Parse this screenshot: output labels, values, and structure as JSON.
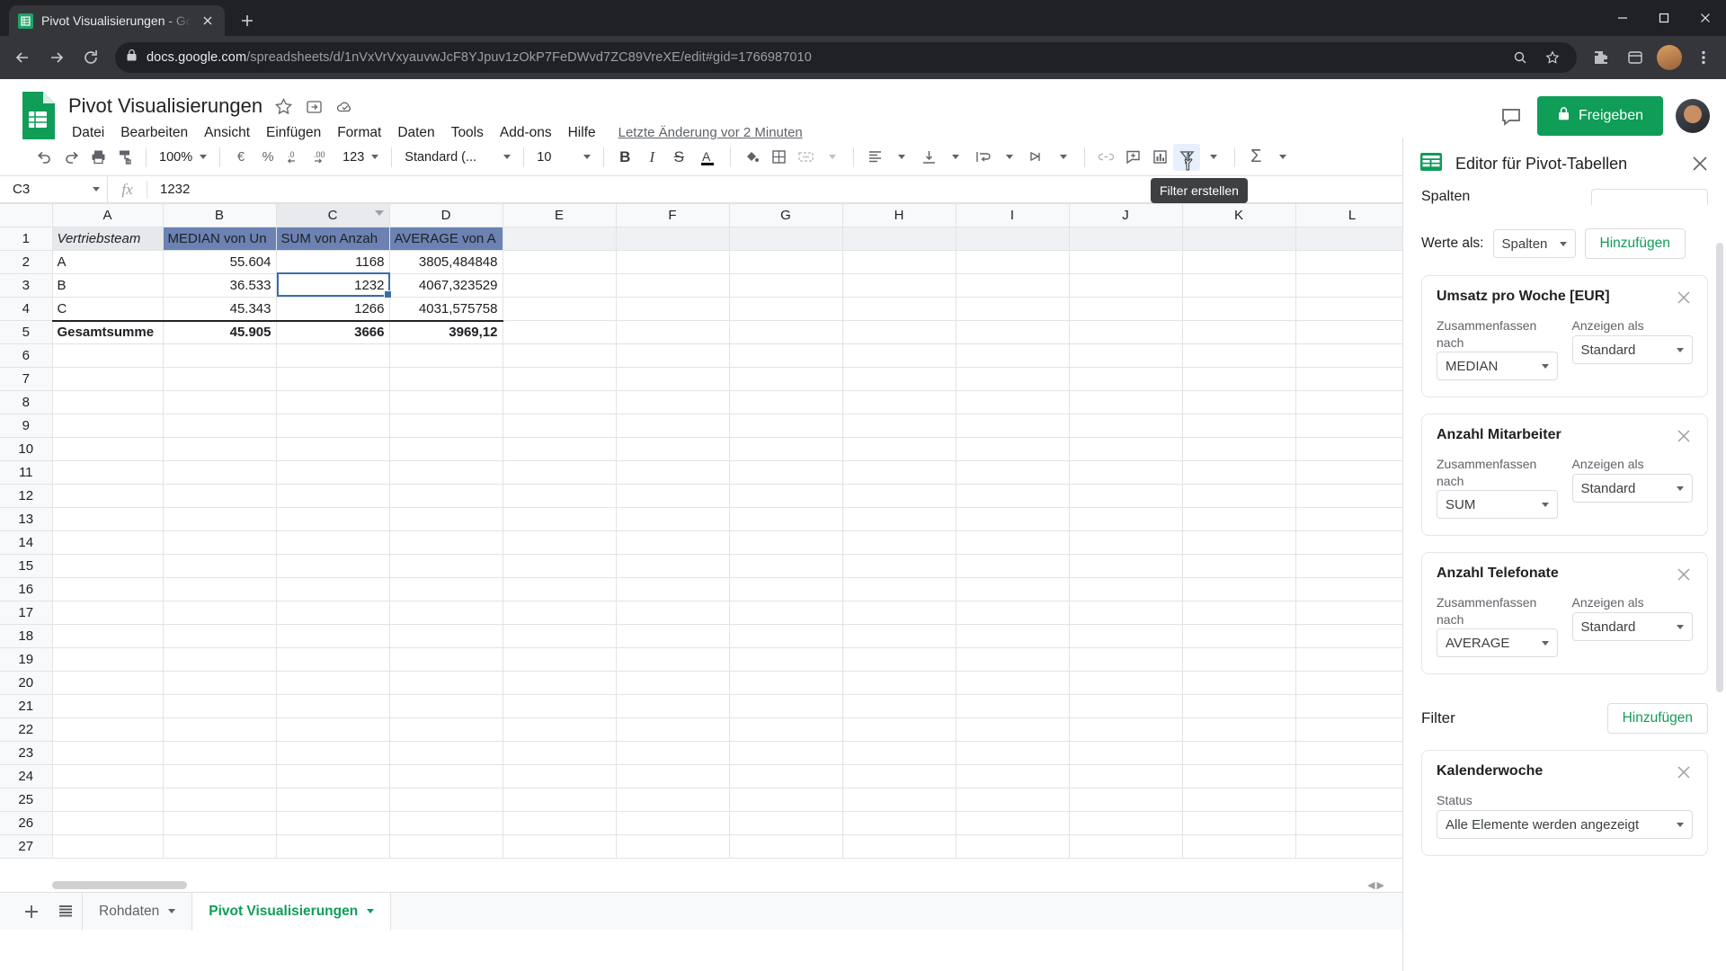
{
  "browser": {
    "tab": {
      "title": "Pivot Visualisierungen - Google T",
      "favicon": "sheets-icon",
      "close": "close-icon"
    },
    "new_tab_label": "+",
    "window_controls": {
      "minimize": "minimize-icon",
      "maximize": "maximize-icon",
      "close": "close-icon"
    },
    "nav": {
      "back": "back-arrow-icon",
      "forward": "forward-arrow-icon",
      "reload": "reload-icon"
    },
    "omnibox": {
      "lock": "lock-icon",
      "domain": "docs.google.com",
      "path": "/spreadsheets/d/1nVxVrVxyauvwJcF8YJpuv1zOkP7FeDWvd7ZC89VreXE/edit#gid=1766987010",
      "zoom_icon": "zoom-icon",
      "star_icon": "star-icon",
      "extensions_icon": "extensions-icon",
      "profile_icon": "profile-icon",
      "menu_icon": "more-vert-icon"
    }
  },
  "docs": {
    "title": "Pivot Visualisierungen",
    "title_icons": [
      "star-icon",
      "move-to-folder-icon",
      "cloud-saved-icon"
    ],
    "menus": [
      "Datei",
      "Bearbeiten",
      "Ansicht",
      "Einfügen",
      "Format",
      "Daten",
      "Tools",
      "Add-ons",
      "Hilfe"
    ],
    "last_edit": "Letzte Änderung vor 2 Minuten",
    "comment_icon": "comment-icon",
    "share_label": "Freigeben",
    "share_icon": "lock-icon",
    "avatar": "user-avatar"
  },
  "toolbar": {
    "zoom_value": "100%",
    "font_family": "Standard (...",
    "font_size": "10",
    "number_format_123": "123",
    "items": [
      "undo-icon",
      "redo-icon",
      "print-icon",
      "paint-format-icon",
      "currency-euro-icon",
      "percent-icon",
      "decrease-decimal-icon",
      "increase-decimal-icon",
      "bold-icon",
      "italic-icon",
      "strikethrough-icon",
      "text-color-icon",
      "fill-color-icon",
      "borders-icon",
      "merge-cells-icon",
      "horizontal-align-icon",
      "vertical-align-icon",
      "text-wrap-icon",
      "text-rotation-icon",
      "insert-link-icon",
      "insert-comment-icon",
      "insert-chart-icon",
      "filter-icon",
      "functions-icon",
      "collapse-toolbar-icon"
    ],
    "tooltip": "Filter erstellen"
  },
  "formula_bar": {
    "name_box": "C3",
    "fx_label": "fx",
    "value": "1232"
  },
  "grid": {
    "columns": [
      "A",
      "B",
      "C",
      "D",
      "E",
      "F",
      "G",
      "H",
      "I",
      "J",
      "K",
      "L"
    ],
    "selected_column": "C",
    "rows": [
      "1",
      "2",
      "3",
      "4",
      "5",
      "6",
      "7",
      "8",
      "9",
      "10",
      "11",
      "12",
      "13",
      "14",
      "15",
      "16",
      "17",
      "18",
      "19",
      "20",
      "21",
      "22",
      "23",
      "24",
      "25",
      "26",
      "27"
    ],
    "selected_cell": "C3",
    "data": [
      {
        "row": "1",
        "cells": [
          "Vertriebsteam",
          "MEDIAN von Un",
          "SUM von Anzah",
          "AVERAGE von A"
        ],
        "style": "header"
      },
      {
        "row": "2",
        "cells": [
          "A",
          "55.604",
          "1168",
          "3805,484848"
        ],
        "style": "data"
      },
      {
        "row": "3",
        "cells": [
          "B",
          "36.533",
          "1232",
          "4067,323529"
        ],
        "style": "data"
      },
      {
        "row": "4",
        "cells": [
          "C",
          "45.343",
          "1266",
          "4031,575758"
        ],
        "style": "data"
      },
      {
        "row": "5",
        "cells": [
          "Gesamtsumme",
          "45.905",
          "3666",
          "3969,12"
        ],
        "style": "total"
      }
    ]
  },
  "sheet_tabs": {
    "add_icon": "add-sheet-icon",
    "all_sheets_icon": "all-sheets-icon",
    "tabs": [
      {
        "label": "Rohdaten",
        "active": false
      },
      {
        "label": "Pivot Visualisierungen",
        "active": true
      }
    ],
    "explore_icon": "explore-icon",
    "expand_icon": "chevron-left-icon"
  },
  "sidebar": {
    "icon": "pivot-table-icon",
    "title": "Editor für Pivot-Tabellen",
    "close_icon": "close-icon",
    "clipped_section_label": "Spalten",
    "values_as_label": "Werte als:",
    "values_as_value": "Spalten",
    "values_add_label": "Hinzufügen",
    "summarize_label": "Zusammenfassen nach",
    "display_as_label": "Anzeigen als",
    "value_cards": [
      {
        "title": "Umsatz pro Woche [EUR]",
        "summarize": "MEDIAN",
        "display_as": "Standard"
      },
      {
        "title": "Anzahl Mitarbeiter",
        "summarize": "SUM",
        "display_as": "Standard"
      },
      {
        "title": "Anzahl Telefonate",
        "summarize": "AVERAGE",
        "display_as": "Standard"
      }
    ],
    "filter_label": "Filter",
    "filter_add_label": "Hinzufügen",
    "filter_cards": [
      {
        "title": "Kalenderwoche",
        "status_label": "Status",
        "status_value": "Alle Elemente werden angezeigt"
      }
    ]
  },
  "colors": {
    "brand_green": "#0f9d58",
    "pivot_header_blue": "#6b82b3",
    "selection_blue": "#3a6ea8",
    "chrome_dark": "#202124"
  }
}
